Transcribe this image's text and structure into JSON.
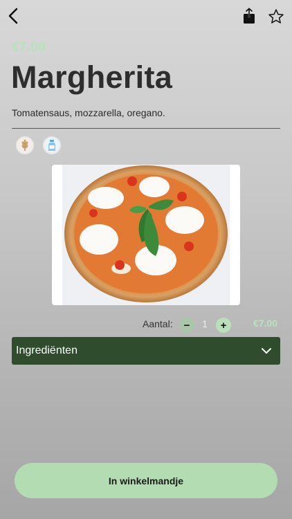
{
  "header": {
    "back_icon": "chevron-left-icon",
    "share_icon": "share-icon",
    "favorite_icon": "star-icon"
  },
  "product": {
    "price_top": "€7.00",
    "name": "Margherita",
    "description": "Tomatensaus, mozzarella, oregano.",
    "allergens": [
      "gluten-icon",
      "lactose-icon"
    ],
    "image": "margherita-pizza-photo"
  },
  "quantity": {
    "label": "Aantal:",
    "value": "1",
    "minus": "−",
    "plus": "+",
    "price": "€7.00"
  },
  "ingredients": {
    "label": "Ingrediënten",
    "expand_icon": "chevron-down-icon"
  },
  "cart": {
    "label": "In winkelmandje"
  },
  "colors": {
    "accent_green": "#b3dcb3",
    "dark_green": "#2f4d2c",
    "price_green": "#b7e2bb"
  }
}
